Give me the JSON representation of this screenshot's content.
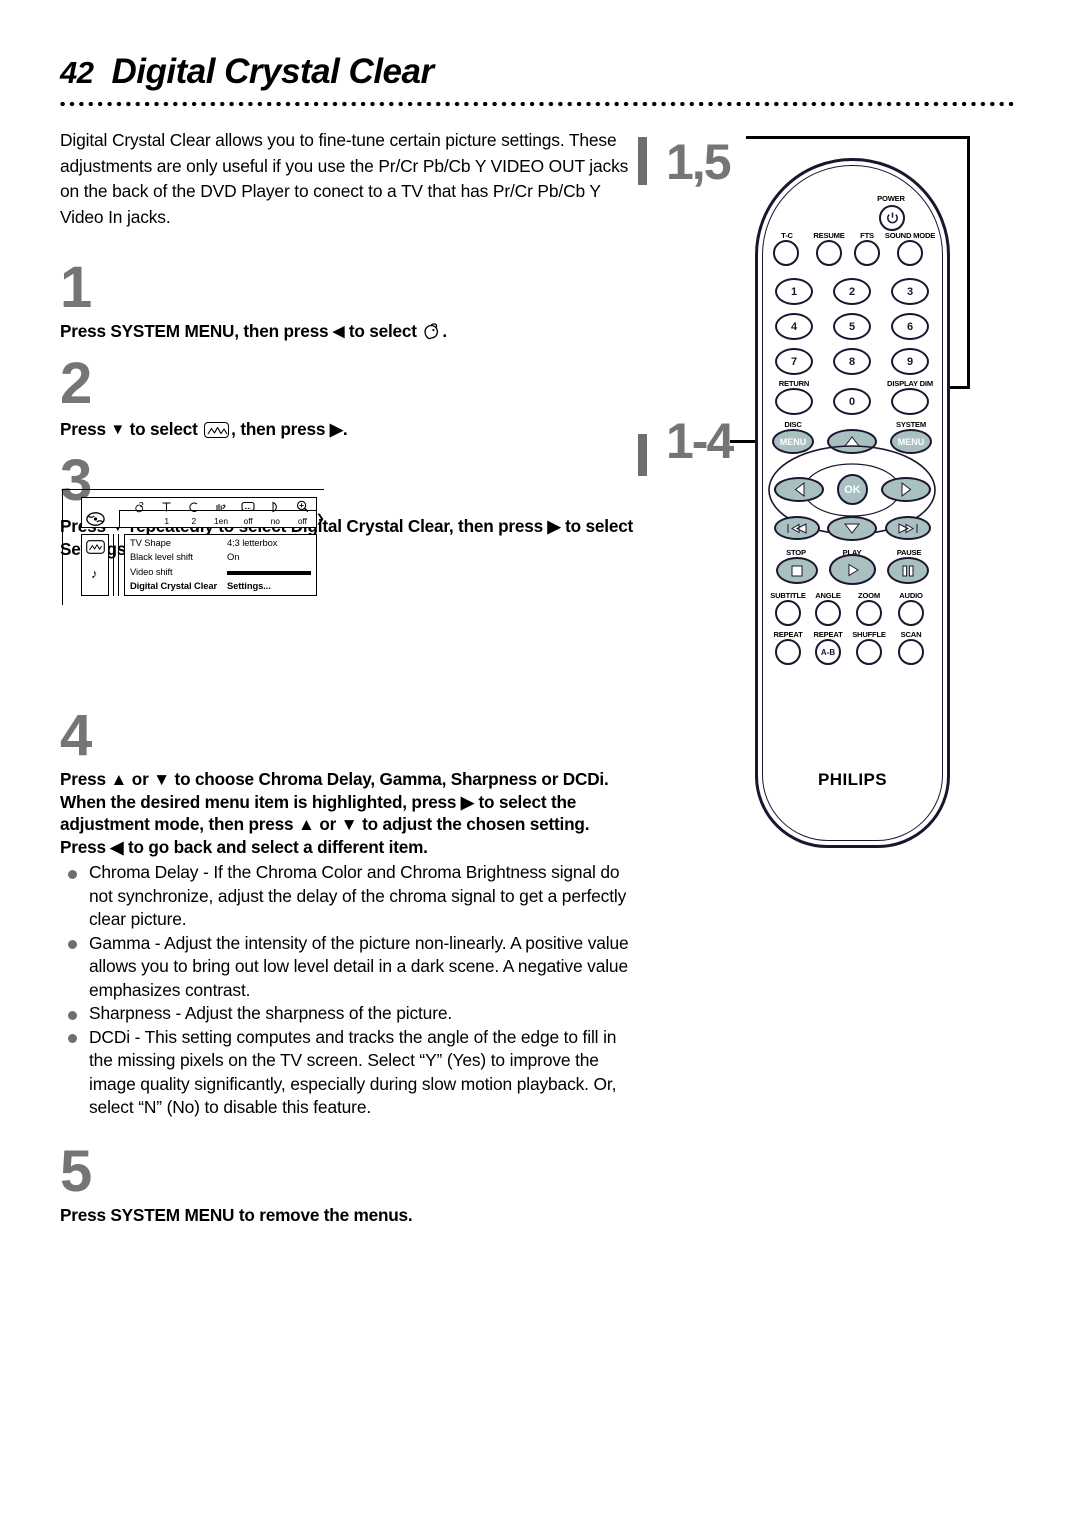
{
  "header": {
    "page_number": "42",
    "title": "Digital Crystal Clear"
  },
  "intro": "Digital Crystal Clear allows you to fine-tune certain picture settings. These adjustments are only useful if you use the Pr/Cr Pb/Cb Y VIDEO OUT jacks on the back of the DVD Player to conect to a TV that has Pr/Cr Pb/Cb Y Video In jacks.",
  "steps": [
    {
      "number": "1",
      "text_before": "Press SYSTEM MENU, then press",
      "arrow": "◀",
      "text_after": "to select",
      "trailing": "."
    },
    {
      "number": "2",
      "text_before": "Press",
      "arrow": "▼",
      "text_after": "to select",
      "trailing": ", then press ▶."
    },
    {
      "number": "3",
      "text_before": "Press",
      "arrow": "▼",
      "text_after": "repeatedly to select Digital Crystal Clear, then press ▶ to select Settings."
    },
    {
      "number": "4",
      "text": "Press ▲ or ▼ to choose Chroma Delay, Gamma, Sharpness or DCDi. When the desired menu item is highlighted, press ▶ to select the adjustment mode, then press ▲ or ▼ to adjust the chosen setting. Press ◀ to go back and select a different item."
    },
    {
      "number": "5",
      "text": "Press SYSTEM MENU to remove the menus."
    }
  ],
  "bullets": [
    "Chroma Delay - If the Chroma Color and Chroma Brightness signal do not synchronize, adjust the delay of the chroma signal to get a perfectly clear picture.",
    "Gamma - Adjust the intensity of the picture non-linearly. A positive value allows you to bring out low level detail in a dark scene. A negative value emphasizes contrast.",
    "Sharpness - Adjust the sharpness of the picture.",
    "DCDi - This setting computes and tracks the angle of the edge to fill in the missing pixels on the TV screen. Select “Y” (Yes) to improve the image quality significantly, especially during slow motion playback. Or, select “N” (No) to disable this feature."
  ],
  "osd": {
    "top_icons": [
      "disc-icon",
      "title-icon",
      "chapter-icon",
      "subtitle-icon",
      "display-icon",
      "angle-icon",
      "zoom-icon"
    ],
    "top_values": [
      "1",
      "2",
      "1en",
      "off",
      "no",
      "off"
    ],
    "side_icons": [
      "picture-settings-icon",
      "sound-settings-icon"
    ],
    "rows": [
      {
        "label": "TV Shape",
        "value": "4:3 letterbox",
        "selected": false
      },
      {
        "label": "Black level shift",
        "value": "On",
        "selected": false
      },
      {
        "label": "Video shift",
        "value": "",
        "selected": false,
        "is_bar": true
      },
      {
        "label": "Digital Crystal Clear",
        "value": "Settings...",
        "selected": true
      }
    ]
  },
  "remote": {
    "callouts": [
      {
        "id": "callout-1-5",
        "label": "1,5"
      },
      {
        "id": "callout-1-4",
        "label": "1-4"
      }
    ],
    "brand": "PHILIPS",
    "power_label": "POWER",
    "top_row": [
      "T-C",
      "RESUME",
      "FTS",
      "SOUND MODE"
    ],
    "keypad": [
      "1",
      "2",
      "3",
      "4",
      "5",
      "6",
      "7",
      "8",
      "9",
      "0"
    ],
    "return_label": "RETURN",
    "display_dim_label": "DISPLAY DIM",
    "disc_label": "DISC",
    "system_label": "SYSTEM",
    "disc_menu_label": "MENU",
    "system_menu_label": "MENU",
    "ok_label": "OK",
    "transport_labels": [
      "STOP",
      "PLAY",
      "PAUSE"
    ],
    "feature_row_1": [
      "SUBTITLE",
      "ANGLE",
      "ZOOM",
      "AUDIO"
    ],
    "feature_row_2": [
      "REPEAT",
      "REPEAT",
      "SHUFFLE",
      "SCAN"
    ],
    "repeat_ab_label": "A-B"
  },
  "colors": {
    "step_number": "#757575",
    "remote_outline": "#1b1630",
    "nav_button": "#a9c0c0",
    "bullet": "#6e6e6e",
    "change_bar": "#6e6e6e"
  }
}
